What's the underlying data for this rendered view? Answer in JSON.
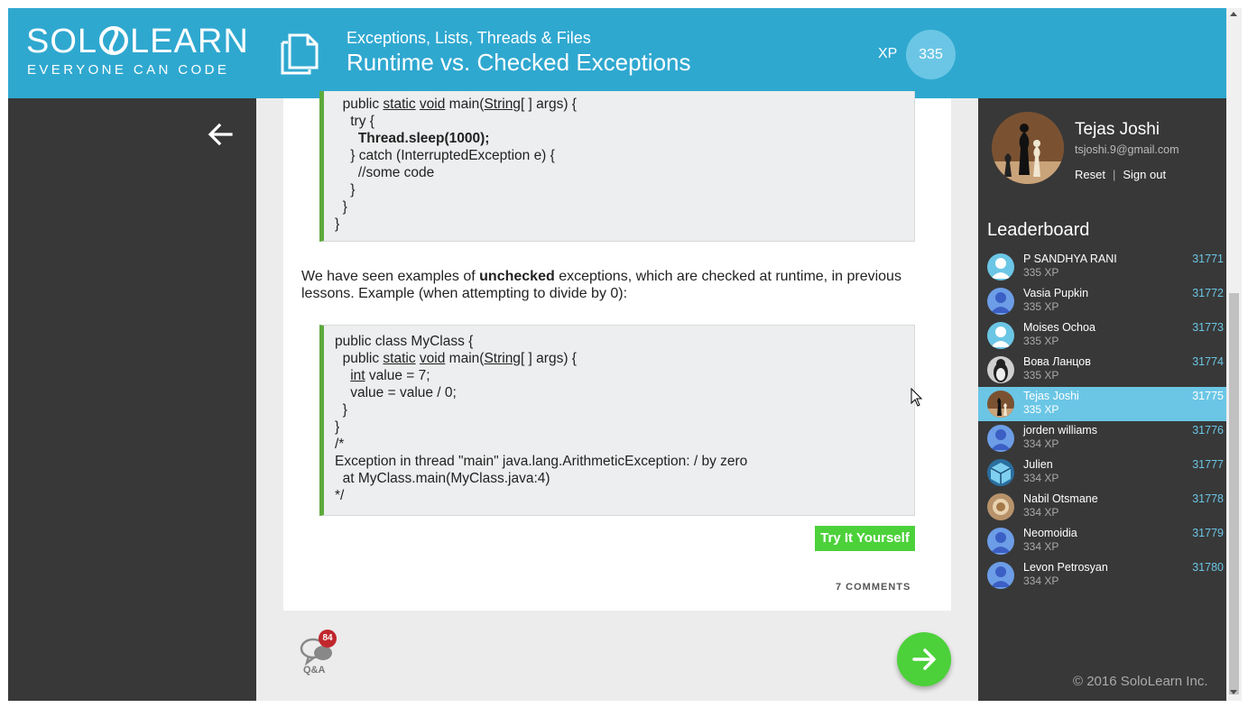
{
  "header": {
    "logo_text": "SOLO LEARN",
    "logo_main_left": "SOL",
    "logo_main_right": "LEARN",
    "logo_tagline": "EVERYONE CAN CODE",
    "course_title": "Exceptions, Lists, Threads & Files",
    "lesson_title": "Runtime vs. Checked Exceptions",
    "xp_label": "XP",
    "xp_value": "335"
  },
  "lesson": {
    "code_block_1": [
      "  public static void main(String[ ] args) {",
      "    try {",
      "      Thread.sleep(1000);",
      "    } catch (InterruptedException e) {",
      "      //some code",
      "    }",
      "  }",
      "}"
    ],
    "paragraph_pre": "We have seen examples of ",
    "paragraph_bold": "unchecked",
    "paragraph_post": " exceptions, which are checked at runtime, in previous lessons. Example (when attempting to divide by 0):",
    "code_block_2": [
      "public class MyClass {",
      "  public static void main(String[ ] args) {",
      "    int value = 7;",
      "    value = value / 0;",
      "  }",
      "}",
      "/*",
      "Exception in thread \"main\" java.lang.ArithmeticException: / by zero",
      "  at MyClass.main(MyClass.java:4)",
      "*/"
    ],
    "try_button": "Try It Yourself",
    "comments_label": "7 COMMENTS",
    "qa_label": "Q&A",
    "qa_badge": "84"
  },
  "user": {
    "name": "Tejas Joshi",
    "email": "tsjoshi.9@gmail.com",
    "reset_label": "Reset",
    "signout_label": "Sign out"
  },
  "leaderboard": {
    "title": "Leaderboard",
    "entries": [
      {
        "name": "P SANDHYA RANI",
        "xp": "335 XP",
        "rank": "31771",
        "avatar": "default-user"
      },
      {
        "name": "Vasia Pupkin",
        "xp": "335 XP",
        "rank": "31772",
        "avatar": "blue-user"
      },
      {
        "name": "Moises Ochoa",
        "xp": "335 XP",
        "rank": "31773",
        "avatar": "default-user"
      },
      {
        "name": "Вова Ланцов",
        "xp": "335 XP",
        "rank": "31774",
        "avatar": "penguin"
      },
      {
        "name": "Tejas Joshi",
        "xp": "335 XP",
        "rank": "31775",
        "avatar": "chess",
        "active": true
      },
      {
        "name": "jorden williams",
        "xp": "334 XP",
        "rank": "31776",
        "avatar": "blue-user"
      },
      {
        "name": "Julien",
        "xp": "334 XP",
        "rank": "31777",
        "avatar": "cube"
      },
      {
        "name": "Nabil Otsmane",
        "xp": "334 XP",
        "rank": "31778",
        "avatar": "photo"
      },
      {
        "name": "Neomoidia",
        "xp": "334 XP",
        "rank": "31779",
        "avatar": "blue-user"
      },
      {
        "name": "Levon Petrosyan",
        "xp": "334 XP",
        "rank": "31780",
        "avatar": "blue-user"
      }
    ]
  },
  "footer": {
    "copyright": "© 2016 SoloLearn Inc."
  },
  "colors": {
    "header_bg": "#2fa8d0",
    "dark_panel": "#383838",
    "accent_green": "#4cd13a",
    "code_border": "#5daa3b",
    "active_row": "#6bc6e5",
    "badge_red": "#c0282d"
  }
}
